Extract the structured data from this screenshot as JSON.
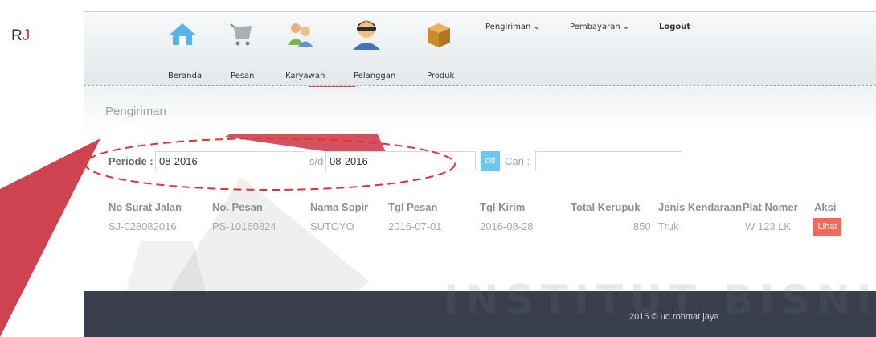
{
  "brand": {
    "text": "R",
    "accent": "J"
  },
  "nav": {
    "icons": [
      {
        "label": "Beranda",
        "icon": "home-icon"
      },
      {
        "label": "Pesan",
        "icon": "cart-icon"
      },
      {
        "label": "Karyawan",
        "icon": "employees-icon"
      },
      {
        "label": "Pelanggan",
        "icon": "customer-icon"
      },
      {
        "label": "Produk",
        "icon": "box-icon"
      }
    ],
    "menus": [
      {
        "label": "Pengiriman ⌄"
      },
      {
        "label": "Pembayaran ⌄"
      },
      {
        "label": "Logout"
      }
    ]
  },
  "page": {
    "title": "Pengiriman"
  },
  "filter": {
    "periode_label": "Periode :",
    "periode_from": "08-2016",
    "sd_label": "s/d",
    "periode_to": "08-2016",
    "dd_label": "dd",
    "search_label": "Cari :",
    "search_value": ""
  },
  "table": {
    "headers": [
      "No Surat Jalan",
      "No. Pesan",
      "Nama Sopir",
      "Tgl Pesan",
      "Tgl Kirim",
      "Total Kerupuk",
      "Jenis Kendaraan",
      "Plat Nomer",
      "Aksi"
    ],
    "rows": [
      {
        "no_surat_jalan": "SJ-028082016",
        "no_pesan": "PS-10160824",
        "nama_sopir": "SUTOYO",
        "tgl_pesan": "2016-07-01",
        "tgl_kirim": "2016-08-28",
        "total_kerupuk": "850",
        "jenis_kendaraan": "Truk",
        "plat_nomer": "W 123 LK",
        "aksi": "Lihat"
      }
    ]
  },
  "footer": {
    "text": "2015 © ud.rohmat jaya"
  },
  "watermark": {
    "text": "INSTITUT BISNIS"
  },
  "colors": {
    "accent_red": "#d9362c",
    "button_blue": "#6cc7f2",
    "button_red": "#f06a5c",
    "footer_bg": "#3a3f4d",
    "annotation_red": "#e3342f",
    "watermark_red": "#c5182a"
  }
}
